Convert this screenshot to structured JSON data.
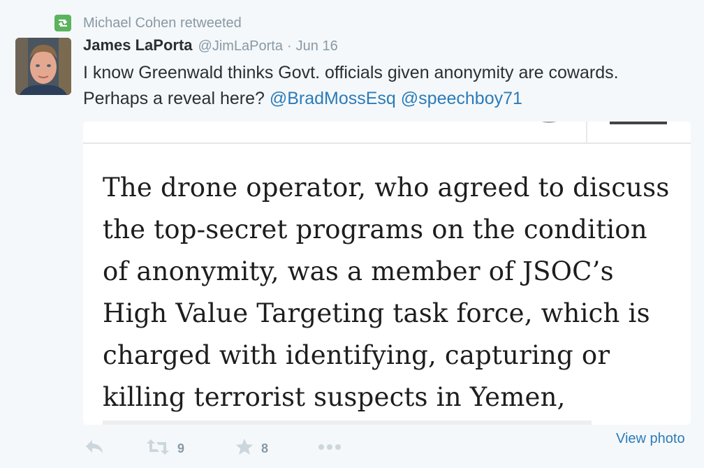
{
  "retweet_context": {
    "icon": "retweet-icon",
    "label": "Michael Cohen retweeted",
    "icon_color": "#5bb35d"
  },
  "tweet": {
    "author_name": "James LaPorta",
    "handle": "@JimLaPorta",
    "separator": "·",
    "date": "Jun 16",
    "text_line1": "I know Greenwald thinks Govt. officials given anonymity are cowards.",
    "text_line2_prefix": "Perhaps a reveal here? ",
    "mention1": "@BradMossEsq",
    "mention2": "@speechboy71",
    "media_quote_lines": [
      "The drone operator, who agreed to discuss",
      "the top-secret programs on the condition",
      "of anonymity, was a member of JSOC’s",
      "High Value Targeting task force, which is",
      "charged with identifying, capturing or",
      "killing terrorist suspects in Yemen,"
    ]
  },
  "actions": {
    "reply_icon": "reply-icon",
    "retweet_icon": "retweet-icon",
    "retweet_count": "9",
    "favorite_icon": "star-icon",
    "favorite_count": "8",
    "more_icon": "more-icon",
    "view_photo": "View photo"
  },
  "colors": {
    "link": "#2b7bb9",
    "muted": "#8899a6",
    "text": "#292f33",
    "background": "#f5f8fa"
  }
}
